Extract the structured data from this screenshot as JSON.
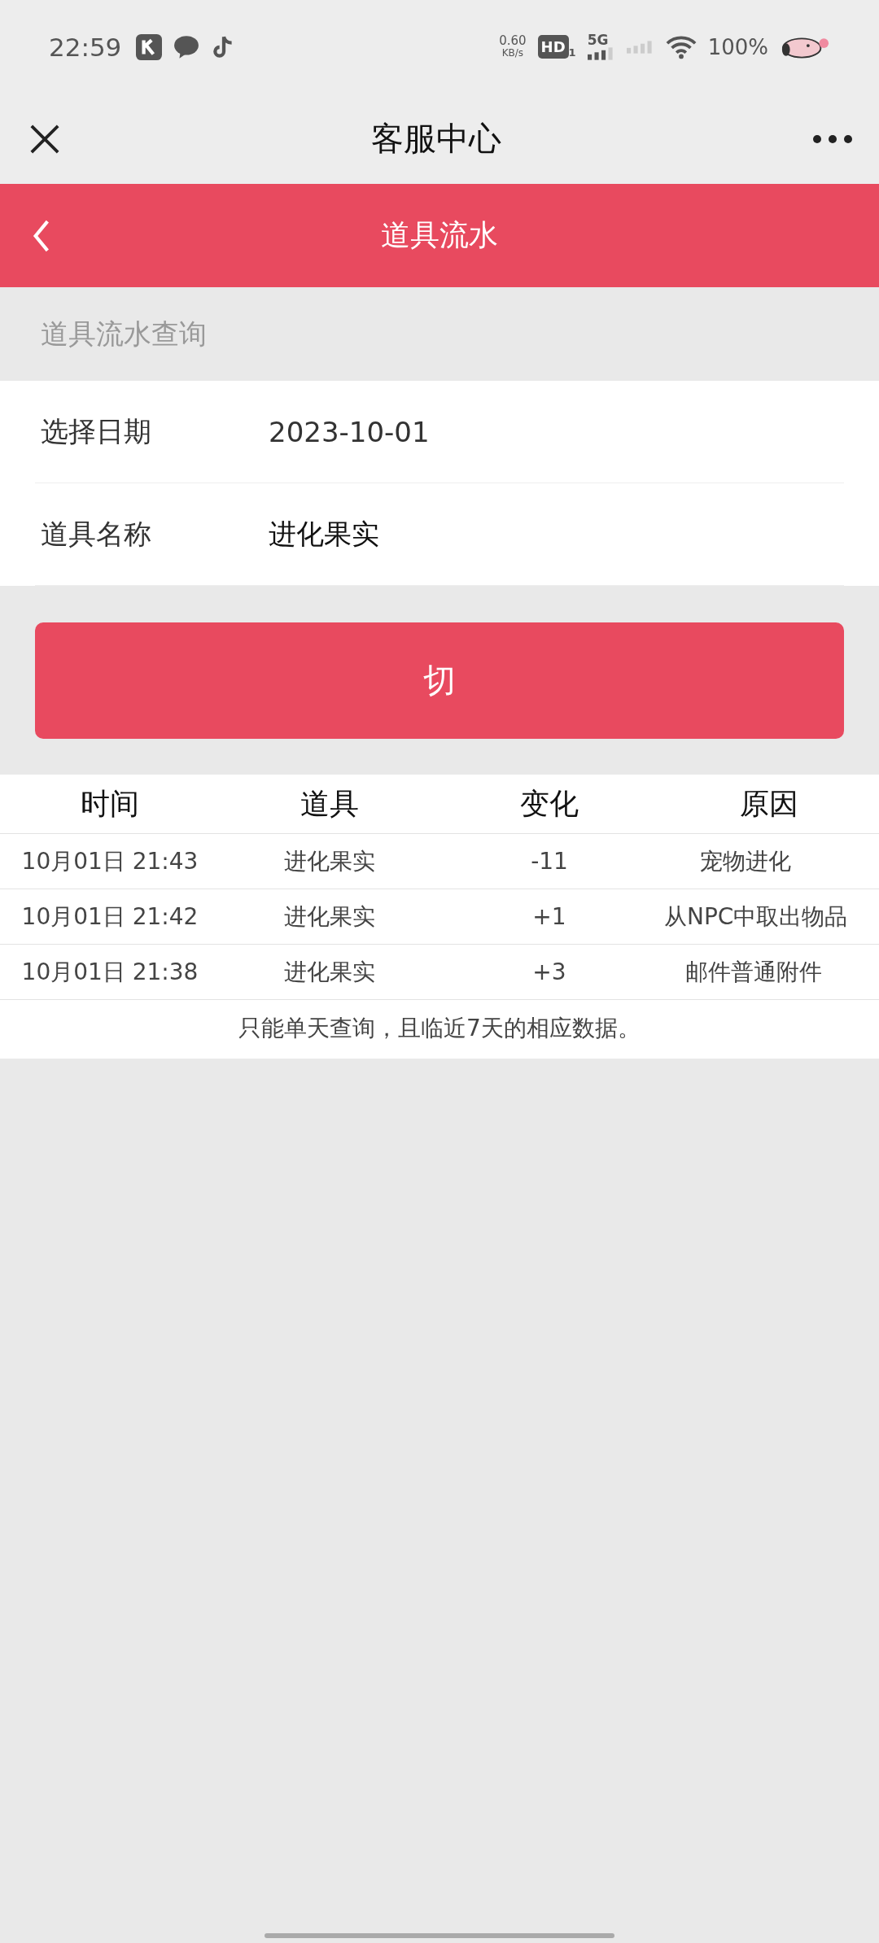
{
  "status_bar": {
    "time": "22:59",
    "net_speed": "0.60",
    "net_unit": "KB/s",
    "hd": "HD",
    "hd_sub": "1",
    "network": "5G",
    "battery": "100%"
  },
  "title_bar": {
    "title": "客服中心"
  },
  "header": {
    "title": "道具流水"
  },
  "section": {
    "title": "道具流水查询"
  },
  "form": [
    {
      "label": "选择日期",
      "value": "2023-10-01"
    },
    {
      "label": "道具名称",
      "value": "进化果实"
    }
  ],
  "submit_button": {
    "label": "切"
  },
  "table": {
    "columns": [
      "时间",
      "道具",
      "变化",
      "原因"
    ],
    "rows": [
      [
        "10月01日  21:43",
        "进化果实",
        "-11",
        "宠物进化"
      ],
      [
        "10月01日  21:42",
        "进化果实",
        "+1",
        "从NPC中取出物品"
      ],
      [
        "10月01日  21:38",
        "进化果实",
        "+3",
        "邮件普通附件"
      ]
    ],
    "note": "只能单天查询，且临近7天的相应数据。"
  }
}
